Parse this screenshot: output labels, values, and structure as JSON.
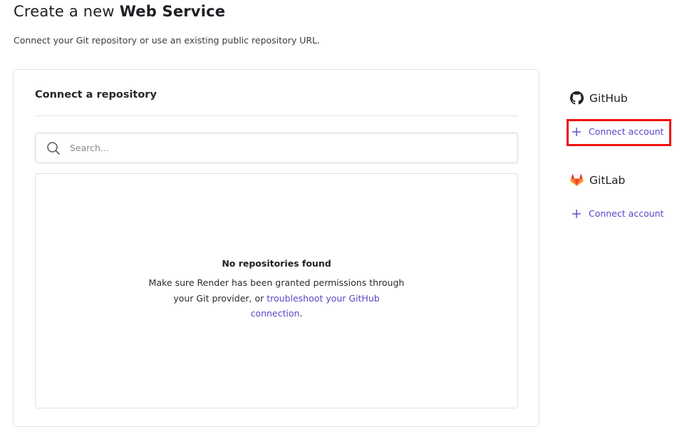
{
  "header": {
    "title_prefix": "Create a new ",
    "title_emphasis": "Web Service",
    "subtitle": "Connect your Git repository or use an existing public repository URL."
  },
  "repository_card": {
    "title": "Connect a repository",
    "search": {
      "placeholder": "Search...",
      "value": ""
    },
    "empty_state": {
      "title": "No repositories found",
      "text_before_link": "Make sure Render has been granted permissions through your Git provider, or ",
      "link_text": "troubleshoot your GitHub connection",
      "text_after_link": "."
    }
  },
  "providers": [
    {
      "name": "GitHub",
      "icon": "github-icon",
      "action_label": "Connect account",
      "icon_color": "#1f1f24"
    },
    {
      "name": "GitLab",
      "icon": "gitlab-icon",
      "action_label": "Connect account",
      "icon_color": "#e24329"
    }
  ],
  "colors": {
    "accent": "#5548c8",
    "highlight": "#ee1111",
    "border": "#e2e2e6"
  }
}
